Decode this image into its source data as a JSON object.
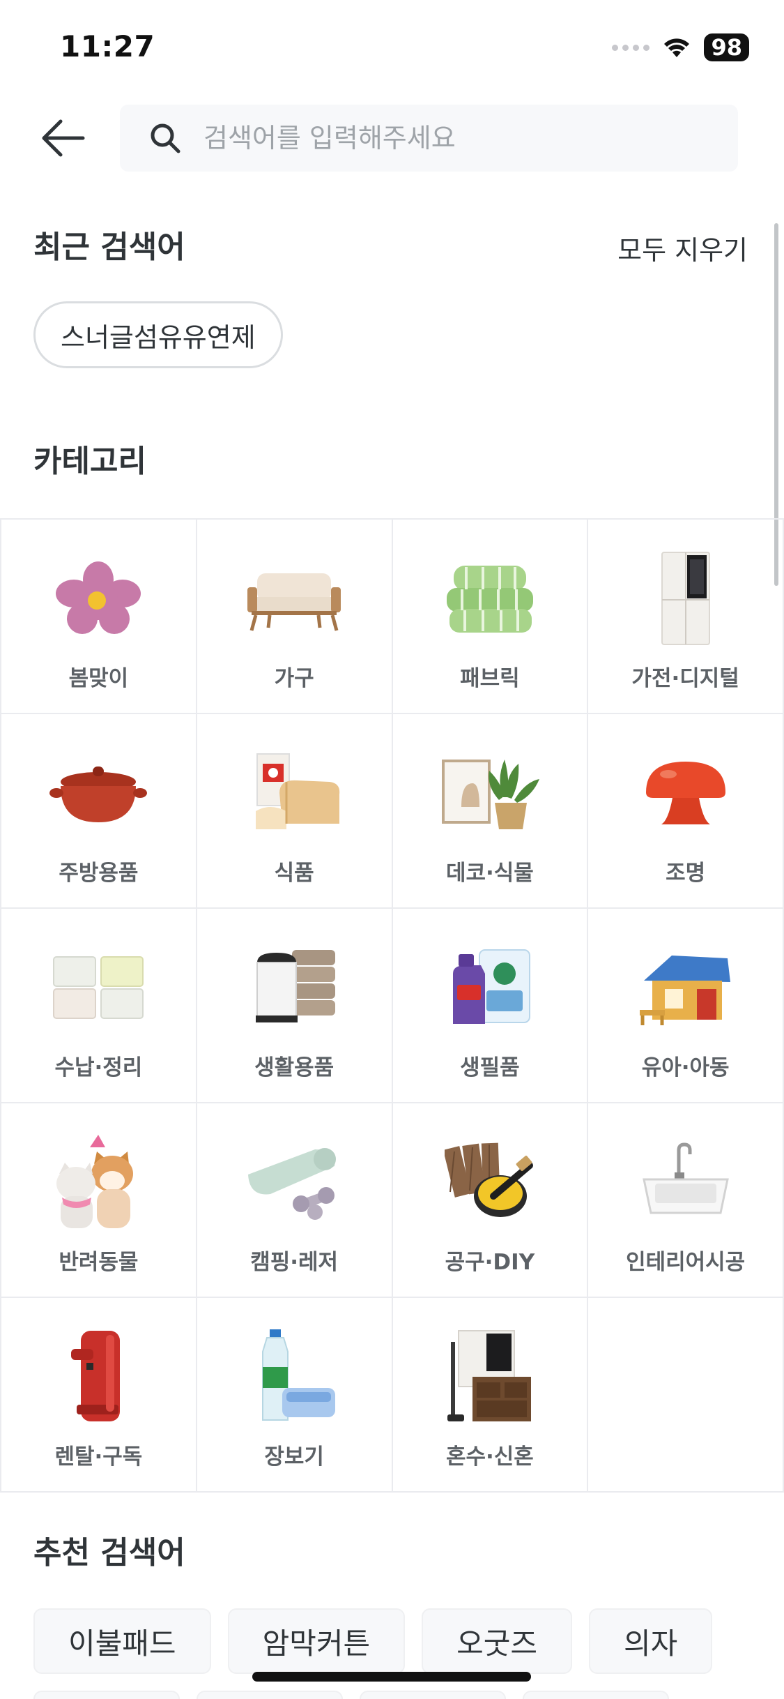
{
  "status_bar": {
    "time": "11:27",
    "battery": "98"
  },
  "search": {
    "placeholder": "검색어를 입력해주세요",
    "value": ""
  },
  "recent": {
    "title": "최근 검색어",
    "clear_label": "모두 지우기",
    "chips": [
      "스너글섬유유연제"
    ]
  },
  "category": {
    "title": "카테고리",
    "items": [
      {
        "label": "봄맞이",
        "icon": "flower-icon"
      },
      {
        "label": "가구",
        "icon": "sofa-icon"
      },
      {
        "label": "패브릭",
        "icon": "blanket-icon"
      },
      {
        "label": "가전·디지털",
        "icon": "fridge-icon"
      },
      {
        "label": "주방용품",
        "icon": "pot-icon"
      },
      {
        "label": "식품",
        "icon": "bread-icon"
      },
      {
        "label": "데코·식물",
        "icon": "plant-icon"
      },
      {
        "label": "조명",
        "icon": "lamp-icon"
      },
      {
        "label": "수납·정리",
        "icon": "storage-box-icon"
      },
      {
        "label": "생활용품",
        "icon": "trash-can-icon"
      },
      {
        "label": "생필품",
        "icon": "detergent-icon"
      },
      {
        "label": "유아·아동",
        "icon": "playhouse-icon"
      },
      {
        "label": "반려동물",
        "icon": "pets-icon"
      },
      {
        "label": "캠핑·레저",
        "icon": "yoga-mat-icon"
      },
      {
        "label": "공구·DIY",
        "icon": "paint-bucket-icon"
      },
      {
        "label": "인테리어시공",
        "icon": "sink-icon"
      },
      {
        "label": "렌탈·구독",
        "icon": "water-purifier-icon"
      },
      {
        "label": "장보기",
        "icon": "water-bottle-icon"
      },
      {
        "label": "혼수·신혼",
        "icon": "appliances-icon"
      }
    ]
  },
  "recommend": {
    "title": "추천 검색어",
    "chips": [
      "이불패드",
      "암막커튼",
      "오굿즈",
      "의자"
    ]
  },
  "colors": {
    "text": "#2f3438",
    "muted": "#9ea3a8",
    "border": "#eaebef",
    "chip_bg": "#f7f8fa"
  }
}
